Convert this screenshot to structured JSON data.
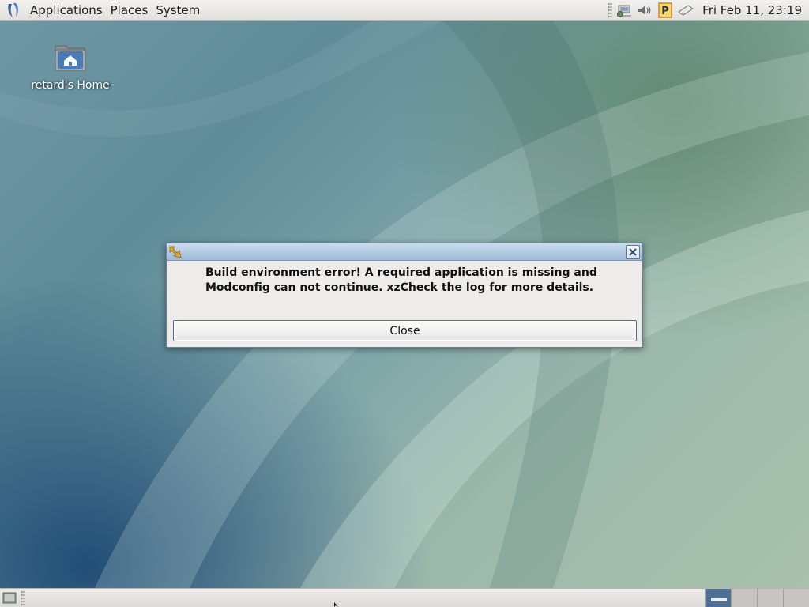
{
  "top_panel": {
    "menus": [
      "Applications",
      "Places",
      "System"
    ],
    "tray_icons": [
      "network-icon",
      "volume-icon",
      "package-updater-icon",
      "notes-icon"
    ],
    "clock": "Fri Feb 11, 23:19"
  },
  "desktop": {
    "icons": [
      {
        "label": "retard's Home",
        "icon": "home-folder-icon"
      }
    ]
  },
  "dialog": {
    "title": "",
    "message": "Build environment error! A required application is missing and Modconfig can not continue. xzCheck the log for more details.",
    "close_button_label": "Close"
  },
  "bottom_panel": {
    "workspace_count": 4,
    "active_workspace": 1
  },
  "colors": {
    "panel_bg": "#e3e1dd",
    "titlebar": "#9fbbd9",
    "active_workspace": "#4f6f95",
    "desktop_base": "#5f8c98"
  }
}
